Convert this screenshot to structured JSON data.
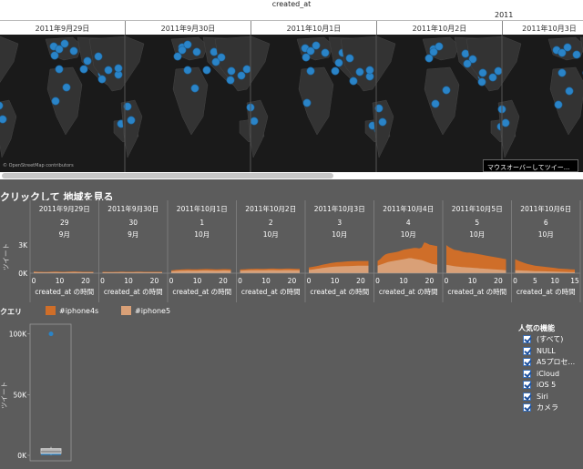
{
  "top_axis": {
    "title": "created_at",
    "year": "2011"
  },
  "map_days": [
    "2011年9月29日",
    "2011年9月30日",
    "2011年10月1日",
    "2011年10月2日",
    "2011年10月3日"
  ],
  "map_credit": "© OpenStreetMap contributors",
  "tooltip": "マウスオーバーしてツイー...",
  "area_section": {
    "title": "クリックして 地域を見る",
    "ylabel": "ツイート",
    "y_ticks": [
      "3K",
      "0K"
    ],
    "xlabel": "created_at の時間",
    "days": [
      {
        "date": "2011年9月29日",
        "day": "29",
        "month": "9月",
        "x_ticks": [
          "0",
          "10",
          "20"
        ]
      },
      {
        "date": "2011年9月30日",
        "day": "30",
        "month": "9月",
        "x_ticks": [
          "0",
          "10",
          "20"
        ]
      },
      {
        "date": "2011年10月1日",
        "day": "1",
        "month": "10月",
        "x_ticks": [
          "0",
          "10",
          "20"
        ]
      },
      {
        "date": "2011年10月2日",
        "day": "2",
        "month": "10月",
        "x_ticks": [
          "0",
          "10",
          "20"
        ]
      },
      {
        "date": "2011年10月3日",
        "day": "3",
        "month": "10月",
        "x_ticks": [
          "0",
          "10",
          "20"
        ]
      },
      {
        "date": "2011年10月4日",
        "day": "4",
        "month": "10月",
        "x_ticks": [
          "0",
          "10",
          "20"
        ]
      },
      {
        "date": "2011年10月5日",
        "day": "5",
        "month": "10月",
        "x_ticks": [
          "0",
          "10",
          "20"
        ]
      },
      {
        "date": "2011年10月6日",
        "day": "6",
        "month": "10月",
        "x_ticks": [
          "0",
          "5",
          "10",
          "15"
        ]
      }
    ]
  },
  "legend": {
    "label": "クエリ",
    "items": [
      {
        "name": "#iphone4s",
        "color": "#cf6e29"
      },
      {
        "name": "#iphone5",
        "color": "#d9a077"
      }
    ]
  },
  "box_plot": {
    "ylabel": "ツイート",
    "y_ticks": [
      "100K",
      "50K",
      "0K"
    ]
  },
  "filter": {
    "title": "人気の機能",
    "items": [
      "(すべて)",
      "NULL",
      "A5プロセ...",
      "iCloud",
      "iOS 5",
      "Siri",
      "カメラ"
    ]
  },
  "chart_data": [
    {
      "type": "area",
      "ylabel": "ツイート",
      "xlabel": "created_at の時間",
      "ylim": [
        0,
        3500
      ],
      "categories": [
        "2011年9月29日",
        "2011年9月30日",
        "2011年10月1日",
        "2011年10月2日",
        "2011年10月3日",
        "2011年10月4日",
        "2011年10月5日",
        "2011年10月6日"
      ],
      "series": [
        {
          "name": "#iphone4s",
          "values": [
            [
              180,
              160,
              150,
              150,
              140,
              140,
              150,
              160,
              170,
              170,
              160,
              150,
              150,
              160,
              170,
              180,
              180,
              170,
              160,
              150,
              150,
              150,
              150,
              150
            ],
            [
              150,
              150,
              140,
              140,
              140,
              150,
              150,
              160,
              160,
              150,
              150,
              150,
              150,
              160,
              160,
              160,
              150,
              150,
              150,
              150,
              150,
              150,
              150,
              150
            ],
            [
              300,
              330,
              360,
              380,
              400,
              420,
              430,
              430,
              420,
              410,
              420,
              430,
              440,
              450,
              450,
              440,
              430,
              420,
              420,
              430,
              440,
              440,
              430,
              420
            ],
            [
              400,
              420,
              430,
              450,
              460,
              470,
              480,
              480,
              470,
              470,
              480,
              490,
              500,
              500,
              490,
              480,
              480,
              490,
              500,
              500,
              490,
              480,
              470,
              460
            ],
            [
              600,
              650,
              700,
              760,
              820,
              880,
              940,
              1000,
              1060,
              1110,
              1150,
              1180,
              1200,
              1220,
              1240,
              1260,
              1270,
              1280,
              1290,
              1300,
              1300,
              1300,
              1300,
              1300
            ],
            [
              1300,
              1500,
              1800,
              2000,
              2100,
              2150,
              2200,
              2250,
              2300,
              2400,
              2500,
              2550,
              2600,
              2650,
              2700,
              2700,
              2650,
              2750,
              3300,
              3200,
              3050,
              3000,
              2950,
              2900
            ],
            [
              3000,
              2800,
              2650,
              2500,
              2450,
              2400,
              2300,
              2250,
              2200,
              2200,
              2150,
              2100,
              2050,
              2000,
              1950,
              1900,
              1850,
              1800,
              1750,
              1700,
              1650,
              1600,
              1550,
              1500
            ],
            [
              1500,
              1300,
              1150,
              1000,
              900,
              800,
              750,
              700,
              650,
              600,
              550,
              500,
              480,
              450,
              420,
              400
            ]
          ]
        },
        {
          "name": "#iphone5",
          "values": [
            [
              120,
              110,
              100,
              100,
              100,
              100,
              100,
              110,
              110,
              110,
              100,
              100,
              100,
              110,
              110,
              120,
              120,
              110,
              110,
              100,
              100,
              100,
              100,
              100
            ],
            [
              100,
              100,
              100,
              100,
              100,
              100,
              100,
              110,
              110,
              100,
              100,
              100,
              100,
              110,
              110,
              110,
              100,
              100,
              100,
              100,
              100,
              100,
              100,
              100
            ],
            [
              200,
              220,
              240,
              250,
              260,
              270,
              280,
              280,
              270,
              270,
              270,
              280,
              290,
              290,
              290,
              280,
              280,
              270,
              270,
              280,
              290,
              290,
              280,
              270
            ],
            [
              270,
              280,
              290,
              300,
              310,
              310,
              320,
              320,
              310,
              310,
              320,
              330,
              330,
              330,
              320,
              320,
              320,
              330,
              330,
              330,
              320,
              320,
              310,
              300
            ],
            [
              350,
              380,
              420,
              460,
              500,
              540,
              580,
              620,
              650,
              680,
              700,
              720,
              730,
              740,
              750,
              760,
              770,
              780,
              790,
              800,
              800,
              800,
              800,
              800
            ],
            [
              800,
              900,
              1000,
              1100,
              1200,
              1250,
              1300,
              1350,
              1400,
              1450,
              1500,
              1550,
              1600,
              1600,
              1550,
              1500,
              1450,
              1400,
              1300,
              1200,
              1100,
              1000,
              950,
              900
            ],
            [
              900,
              850,
              800,
              760,
              720,
              690,
              660,
              640,
              620,
              600,
              580,
              560,
              540,
              520,
              500,
              480,
              460,
              440,
              420,
              400,
              380,
              360,
              340,
              320
            ],
            [
              320,
              300,
              280,
              260,
              240,
              220,
              210,
              200,
              190,
              180,
              170,
              160,
              150,
              140,
              130,
              120
            ]
          ]
        }
      ]
    },
    {
      "type": "box",
      "ylabel": "ツイート",
      "ylim": [
        0,
        105000
      ],
      "outliers": [
        100000
      ],
      "q1": 1500,
      "median": 3000,
      "q3": 5500,
      "whisker_low": 0,
      "whisker_high": 7000
    }
  ]
}
